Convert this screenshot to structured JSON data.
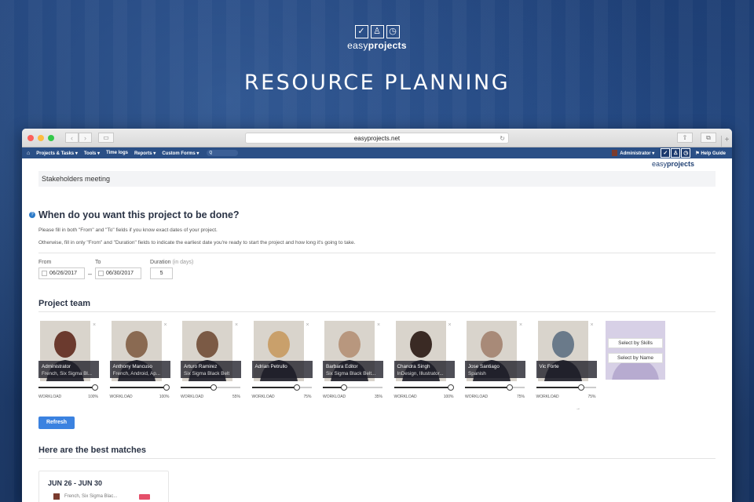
{
  "brand": {
    "icon1": "✓",
    "icon2": "♙",
    "icon3": "◷",
    "text_light": "easy",
    "text_bold": "projects"
  },
  "headline": "RESOURCE PLANNING",
  "browser": {
    "url": "easyprojects.net",
    "icons": {
      "back": "chevron-left-icon",
      "forward": "chevron-right-icon",
      "sidebar": "sidebar-icon",
      "reload": "reload-icon",
      "share": "share-icon",
      "tabs": "tabs-icon",
      "new_tab": "plus-icon"
    }
  },
  "appnav": {
    "home": "⌂",
    "menu": [
      "Projects & Tasks ▾",
      "Tools ▾",
      "Time logs",
      "Reports ▾",
      "Custom Forms ▾"
    ],
    "search_placeholder": "Q",
    "admin": "Administrator ▾",
    "help": "Help Guide"
  },
  "sub_logo": {
    "light": "easy",
    "bold": "projects"
  },
  "project_name": "Stakeholders meeting",
  "schedule": {
    "question": "When do you want this project to be done?",
    "hint1": "Please fill in both \"From\" and \"To\" fields if you know exact dates of your project.",
    "hint2": "Otherwise, fill in only \"From\" and \"Duration\" fields to indicate the earliest date you're ready to start the project and how long it's going to take.",
    "from_label": "From",
    "from_value": "06/26/2017",
    "to_label": "To",
    "to_value": "06/30/2017",
    "duration_label": "Duration",
    "duration_unit": "(in days)",
    "duration_value": "5"
  },
  "team": {
    "title": "Project team",
    "workload_label": "WORKLOAD",
    "members": [
      {
        "name": "Administrator",
        "skills": "French, Six Sigma Bl...",
        "workload": 100,
        "workload_text": "100%",
        "tone": "#6b3a2e"
      },
      {
        "name": "Anthony Mancuso",
        "skills": "French, Android, Ap...",
        "workload": 100,
        "workload_text": "100%",
        "tone": "#8a6a52"
      },
      {
        "name": "Arturo Ramirez",
        "skills": "Six Sigma Black Belt",
        "workload": 55,
        "workload_text": "55%",
        "tone": "#7b5a45"
      },
      {
        "name": "Adrian Petrullo",
        "skills": "",
        "workload": 75,
        "workload_text": "75%",
        "tone": "#c9a06b"
      },
      {
        "name": "Barbara Editor",
        "skills": "Six Sigma Black Belt...",
        "workload": 35,
        "workload_text": "35%",
        "tone": "#b8977e"
      },
      {
        "name": "Chandra Singh",
        "skills": "InDesign, Illustrator...",
        "workload": 100,
        "workload_text": "100%",
        "tone": "#3a2a24"
      },
      {
        "name": "Jose Santiago",
        "skills": "Spanish",
        "workload": 75,
        "workload_text": "75%",
        "tone": "#a88a78"
      },
      {
        "name": "Vic Forte",
        "skills": "",
        "workload": 75,
        "workload_text": "75%",
        "tone": "#6a7a8a"
      }
    ],
    "select_by_skills": "Select by Skills",
    "select_by_name": "Select by Name",
    "refresh": "Refresh",
    "arrow": "→"
  },
  "matches": {
    "title": "Here are the best matches",
    "first_range": "JUN 26 - JUN 30",
    "first_row": "French, Six Sigma Blac..."
  },
  "colors": {
    "accent": "#3b82e0",
    "nav": "#2a4f86",
    "heading": "#2a3345"
  }
}
